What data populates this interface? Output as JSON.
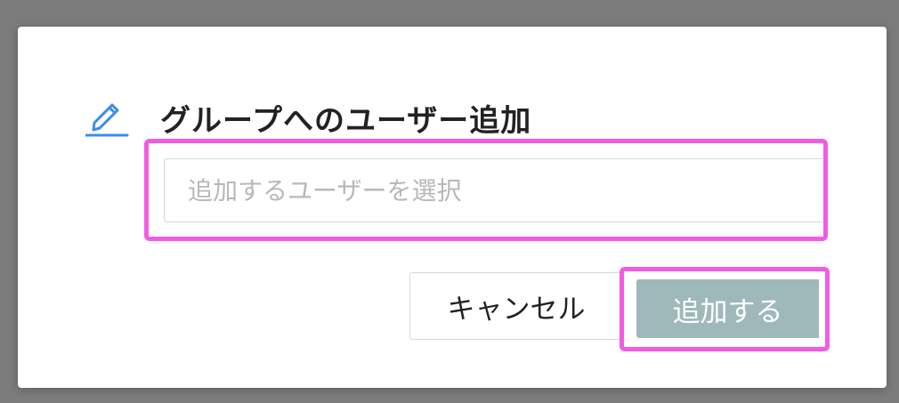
{
  "modal": {
    "title": "グループへのユーザー追加",
    "icon": "pencil-icon",
    "accent_color": "#3b8de8"
  },
  "user_select": {
    "placeholder": "追加するユーザーを選択",
    "value": ""
  },
  "buttons": {
    "cancel_label": "キャンセル",
    "add_label": "追加する",
    "add_color": "#9fb9ba"
  },
  "highlight_color": "#f25be5"
}
